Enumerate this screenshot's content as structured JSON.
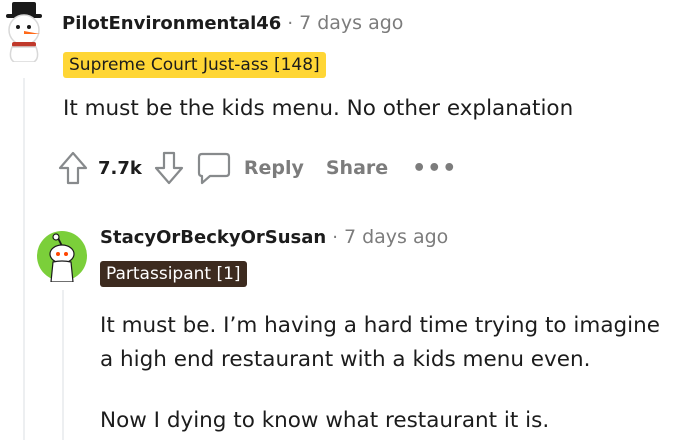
{
  "comments": [
    {
      "author": "PilotEnvironmental46",
      "separator": "·",
      "time": "7 days ago",
      "flair": "Supreme Court Just-ass [148]",
      "body": "It must be the kids menu. No other explanation",
      "actions": {
        "votes": "7.7k",
        "reply": "Reply",
        "share": "Share",
        "more": "•••"
      },
      "avatar": "snowman-avatar-icon",
      "flair_color": "#ffd635"
    },
    {
      "author": "StacyOrBeckyOrSusan",
      "separator": "·",
      "time": "7 days ago",
      "flair": "Partassipant [1]",
      "body_lines": [
        "It must be. I’m having a hard time trying to imagine",
        "a high end restaurant with a kids menu even.",
        "Now I dying to know what restaurant it is."
      ],
      "avatar": "snoo-avatar-icon",
      "avatar_color": "#7bcf3a",
      "flair_color": "#3d2b1f"
    }
  ]
}
